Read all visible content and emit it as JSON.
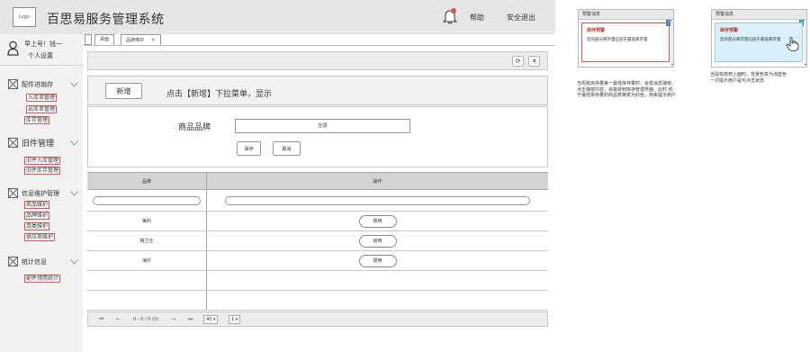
{
  "header": {
    "logo_text": "Logo",
    "title": "百思易服务管理系统",
    "bell_icon": "bell-icon",
    "help_label": "帮助",
    "logout_label": "安全退出"
  },
  "user": {
    "greeting": "早上号！钱一",
    "settings_label": "个人设置"
  },
  "sidebar": {
    "sections": [
      {
        "label": "配件进销存",
        "items": [
          "入库单管理",
          "出库单管理",
          "库存管理"
        ]
      },
      {
        "label": "旧件管理",
        "items": [
          "旧件入库管理",
          "旧件库存管理"
        ]
      },
      {
        "label": "信息维护管理",
        "items": [
          "商品维护",
          "品牌维护",
          "品类维护",
          "供应商维护"
        ]
      },
      {
        "label": "统计信息",
        "items": [
          "配件领用统计"
        ]
      }
    ]
  },
  "tabs": [
    {
      "label": "桌面"
    },
    {
      "label": "品牌维护"
    }
  ],
  "toolbar": {
    "refresh_icon": "refresh-icon",
    "close_icon": "close-icon"
  },
  "actions": {
    "add_label": "新增",
    "hint": "点击【新增】下拉菜单，显示"
  },
  "form": {
    "label": "商品品牌",
    "input_value": "空调",
    "save_label": "保存",
    "cancel_label": "取消"
  },
  "table": {
    "columns": [
      "品牌",
      "操作"
    ],
    "rows": [
      {
        "brand": "美的",
        "action": "禁用"
      },
      {
        "brand": "格兰仕",
        "action": "启用"
      },
      {
        "brand": "海尔",
        "action": "禁用"
      }
    ]
  },
  "pager": {
    "first": "⏮",
    "prev": "←",
    "info": "0 - 0 / 0 (0)",
    "next": "→",
    "last": "⏭",
    "page_size": "40 ▾",
    "page_no": "1 ▾"
  },
  "notes": {
    "card_header": "预警消息",
    "card_title": "库存预警",
    "card_text_a": "您的部分库存量已低于最低库存量",
    "card_text_b": "您的部分库存量已低于最低库存量",
    "badge": "1",
    "note_left_lines": [
      "当现有库存量第一最低库存量时，会有消息弹窗，",
      "点击弹窗内容，会跳转到库存管理界面，此时 低",
      "于最低库存量的商品表格变为红色，用来提示用户"
    ],
    "note_right_lines": [
      "当鼠标放到上面时，背景色变为浅蓝色",
      "一次提示用户是可点击状态"
    ]
  },
  "colors": {
    "header_bg": "#e6e6e6",
    "sidebar_bg": "#f2f2f2",
    "accent_red": "#d9534f",
    "hover_blue": "#d9f0fa"
  }
}
